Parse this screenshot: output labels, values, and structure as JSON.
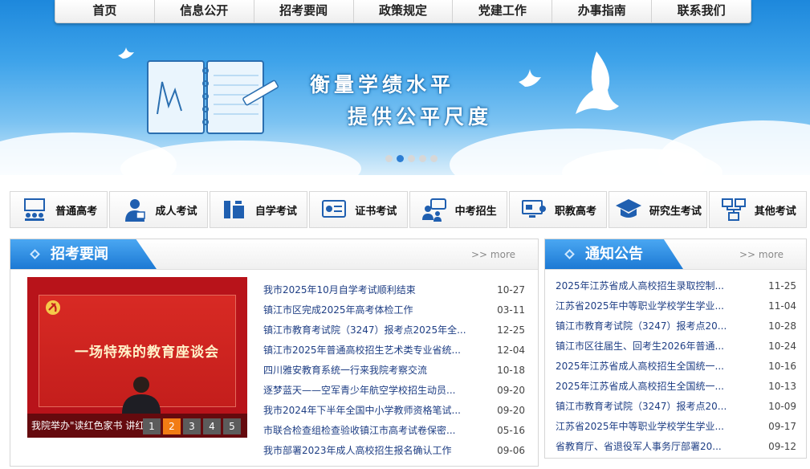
{
  "nav": {
    "items": [
      "首页",
      "信息公开",
      "招考要闻",
      "政策规定",
      "党建工作",
      "办事指南",
      "联系我们"
    ]
  },
  "banner": {
    "slogan_line1": "衡量学绩水平",
    "slogan_line2": "提供公平尺度",
    "slide_count": 5,
    "active_slide": 2
  },
  "categories": [
    {
      "label": "普通高考",
      "icon": "teacher-students-icon"
    },
    {
      "label": "成人考试",
      "icon": "adult-learner-icon"
    },
    {
      "label": "自学考试",
      "icon": "self-study-icon"
    },
    {
      "label": "证书考试",
      "icon": "certificate-icon"
    },
    {
      "label": "中考招生",
      "icon": "students-board-icon"
    },
    {
      "label": "职教高考",
      "icon": "vocational-monitor-icon"
    },
    {
      "label": "研究生考试",
      "icon": "graduation-cap-icon"
    },
    {
      "label": "其他考试",
      "icon": "network-icon"
    }
  ],
  "news_panel": {
    "title": "招考要闻",
    "more": ">> more",
    "photo": {
      "caption": "我院举办\"读红色家书 讲红",
      "board_title": "一场特殊的教育座谈会",
      "pages": [
        "1",
        "2",
        "3",
        "4",
        "5"
      ],
      "active_page": 2
    },
    "items": [
      {
        "title": "我市2025年10月自学考试顺利结束",
        "date": "10-27"
      },
      {
        "title": "镇江市区完成2025年高考体检工作",
        "date": "03-11"
      },
      {
        "title": "镇江市教育考试院（3247）报考点2025年全...",
        "date": "12-25"
      },
      {
        "title": "镇江市2025年普通高校招生艺术类专业省统...",
        "date": "12-04"
      },
      {
        "title": "四川雅安教育系统一行来我院考察交流",
        "date": "10-18"
      },
      {
        "title": "逐梦蓝天——空军青少年航空学校招生动员...",
        "date": "09-20"
      },
      {
        "title": "我市2024年下半年全国中小学教师资格笔试...",
        "date": "09-20"
      },
      {
        "title": "市联合检查组检查验收镇江市高考试卷保密...",
        "date": "05-16"
      },
      {
        "title": "我市部署2023年成人高校招生报名确认工作",
        "date": "09-06"
      }
    ]
  },
  "notice_panel": {
    "title": "通知公告",
    "more": ">> more",
    "items": [
      {
        "title": "2025年江苏省成人高校招生录取控制...",
        "date": "11-25"
      },
      {
        "title": "江苏省2025年中等职业学校学生学业...",
        "date": "11-04"
      },
      {
        "title": "镇江市教育考试院（3247）报考点20...",
        "date": "10-28"
      },
      {
        "title": "镇江市区往届生、回考生2026年普通...",
        "date": "10-24"
      },
      {
        "title": "2025年江苏省成人高校招生全国统一...",
        "date": "10-16"
      },
      {
        "title": "2025年江苏省成人高校招生全国统一...",
        "date": "10-13"
      },
      {
        "title": "镇江市教育考试院（3247）报考点20...",
        "date": "10-09"
      },
      {
        "title": "江苏省2025年中等职业学校学生学业...",
        "date": "09-17"
      },
      {
        "title": "省教育厅、省退役军人事务厅部署20...",
        "date": "09-12"
      }
    ]
  },
  "colors": {
    "accent_blue": "#1c79d4",
    "link_blue": "#1e3e84",
    "active_orange": "#f27c14"
  }
}
